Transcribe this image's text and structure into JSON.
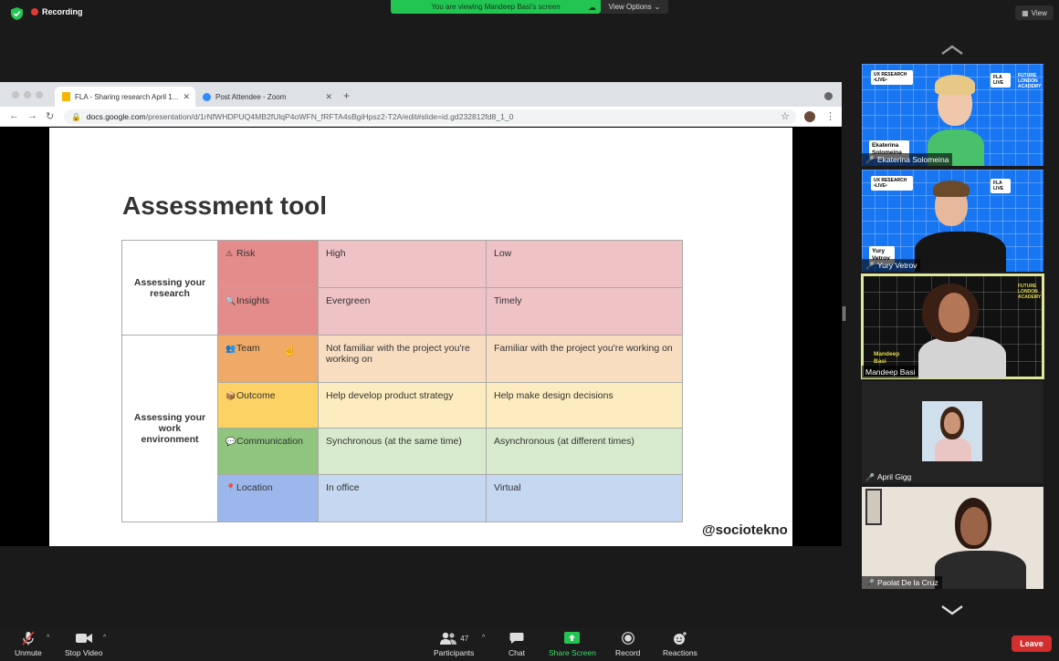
{
  "top": {
    "recording_label": "Recording",
    "banner_text": "You are viewing Mandeep Basi's screen",
    "view_options_label": "View Options",
    "view_label": "View"
  },
  "browser": {
    "tabs": [
      {
        "title": "FLA - Sharing research April 1..."
      },
      {
        "title": "Post Attendee - Zoom"
      }
    ],
    "url_host": "docs.google.com",
    "url_path": "/presentation/d/1rNfWHDPUQ4MB2fUlqP4oWFN_fRFTA4sBgiHpsz2-T2A/edit#slide=id.gd232812fd8_1_0"
  },
  "slide": {
    "title": "Assessment tool",
    "watermark": "@sociotekno",
    "groups": [
      "Assessing your research",
      "Assessing your work environment"
    ],
    "rows": [
      {
        "icon": "⚠",
        "label": "Risk",
        "a": "High",
        "b": "Low",
        "color_cat": "#e48c8c",
        "color_val": "#efc2c6"
      },
      {
        "icon": "🔍",
        "label": "Insights",
        "a": "Evergreen",
        "b": "Timely",
        "color_cat": "#e48c8c",
        "color_val": "#efc2c6"
      },
      {
        "icon": "👥",
        "label": "Team",
        "a": "Not familiar with the project you're working on",
        "b": "Familiar with the project you're working on",
        "color_cat": "#eeaa66",
        "color_val": "#f8ddc1"
      },
      {
        "icon": "📦",
        "label": "Outcome",
        "a": "Help develop product strategy",
        "b": "Help make design decisions",
        "color_cat": "#fdd264",
        "color_val": "#fdecbf"
      },
      {
        "icon": "💬",
        "label": "Communication",
        "a": "Synchronous (at the same time)",
        "b": "Asynchronous (at different times)",
        "color_cat": "#8fc57e",
        "color_val": "#d7eacd"
      },
      {
        "icon": "📍",
        "label": "Location",
        "a": "In office",
        "b": "Virtual",
        "color_cat": "#9cb7eb",
        "color_val": "#c6d7f2"
      }
    ]
  },
  "participants_panel": {
    "tiles": [
      {
        "name": "Ekaterina Solomeina",
        "muted": true,
        "overlay": "Ekaterina Solomeina"
      },
      {
        "name": "Yury Vetrov",
        "muted": true,
        "overlay": "Yury Vetrov"
      },
      {
        "name": "Mandeep Basi",
        "muted": false,
        "overlay": "Mandeep Basi"
      },
      {
        "name": "April Gigg",
        "muted": true
      },
      {
        "name": "Paolat De la Cruz",
        "muted": true
      }
    ],
    "card_text": "UX RESEARCH •LIVE•",
    "fla_badge": "FLA LIVE",
    "academy_text": "FUTURE LONDON ACADEMY"
  },
  "toolbar": {
    "unmute": "Unmute",
    "stop_video": "Stop Video",
    "participants": "Participants",
    "participants_count": "47",
    "chat": "Chat",
    "share_screen": "Share Screen",
    "record": "Record",
    "reactions": "Reactions",
    "leave": "Leave"
  },
  "colors": {
    "share_green": "#23c552",
    "leave_red": "#d32f2f",
    "active_speaker": "#dfe89a"
  }
}
